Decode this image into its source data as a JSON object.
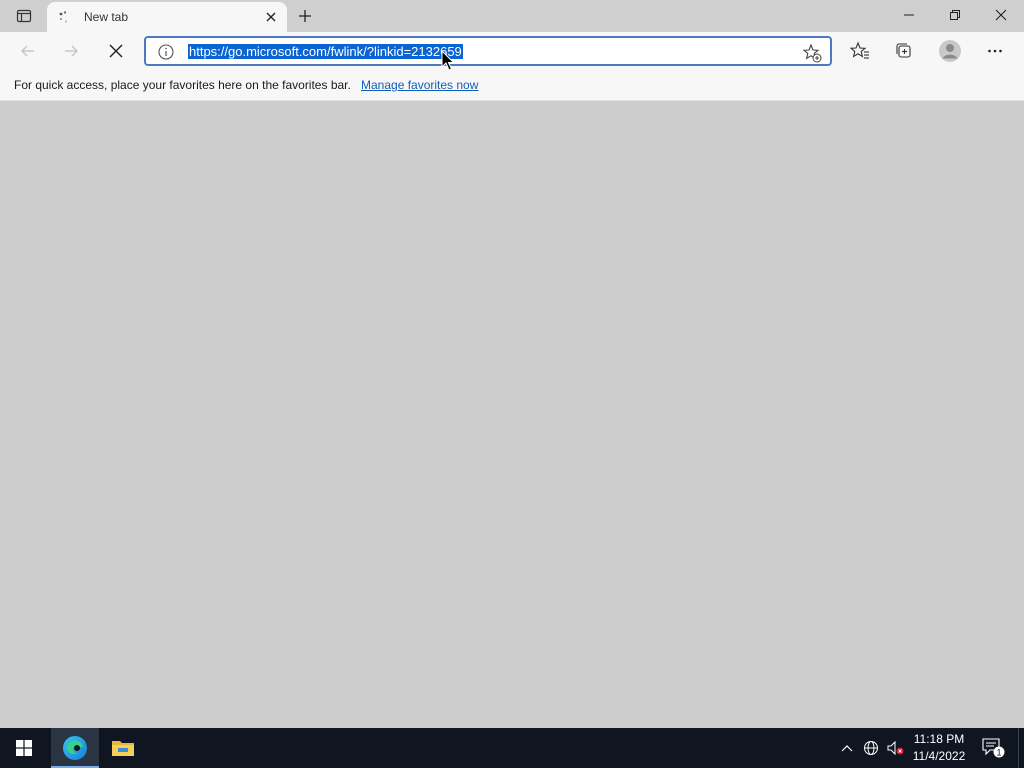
{
  "browser": {
    "tab": {
      "title": "New tab"
    },
    "omnibox": {
      "url": "https://go.microsoft.com/fwlink/?linkid=2132659"
    },
    "favorites_bar": {
      "message": "For quick access, place your favorites here on the favorites bar.",
      "link": "Manage favorites now"
    }
  },
  "icons": {
    "tab_actions": "tab-actions-icon",
    "loading": "loading-spinner-icon",
    "close_tab": "close-icon",
    "new_tab": "plus-icon",
    "back": "arrow-left-icon",
    "forward": "arrow-right-icon",
    "stop": "close-icon",
    "site_info": "info-icon",
    "add_favorite": "star-add-icon",
    "favorites": "favorites-icon",
    "collections": "collections-icon",
    "profile": "profile-icon",
    "more": "more-icon"
  },
  "taskbar": {
    "clock": {
      "time": "11:18 PM",
      "date": "11/4/2022"
    },
    "notification_count": "1",
    "apps": [
      "Microsoft Edge",
      "File Explorer"
    ]
  },
  "colors": {
    "selection": "#0a64d3",
    "accent": "#4a7bc0",
    "taskbar": "#0f1621",
    "link": "#0f5fb8"
  }
}
